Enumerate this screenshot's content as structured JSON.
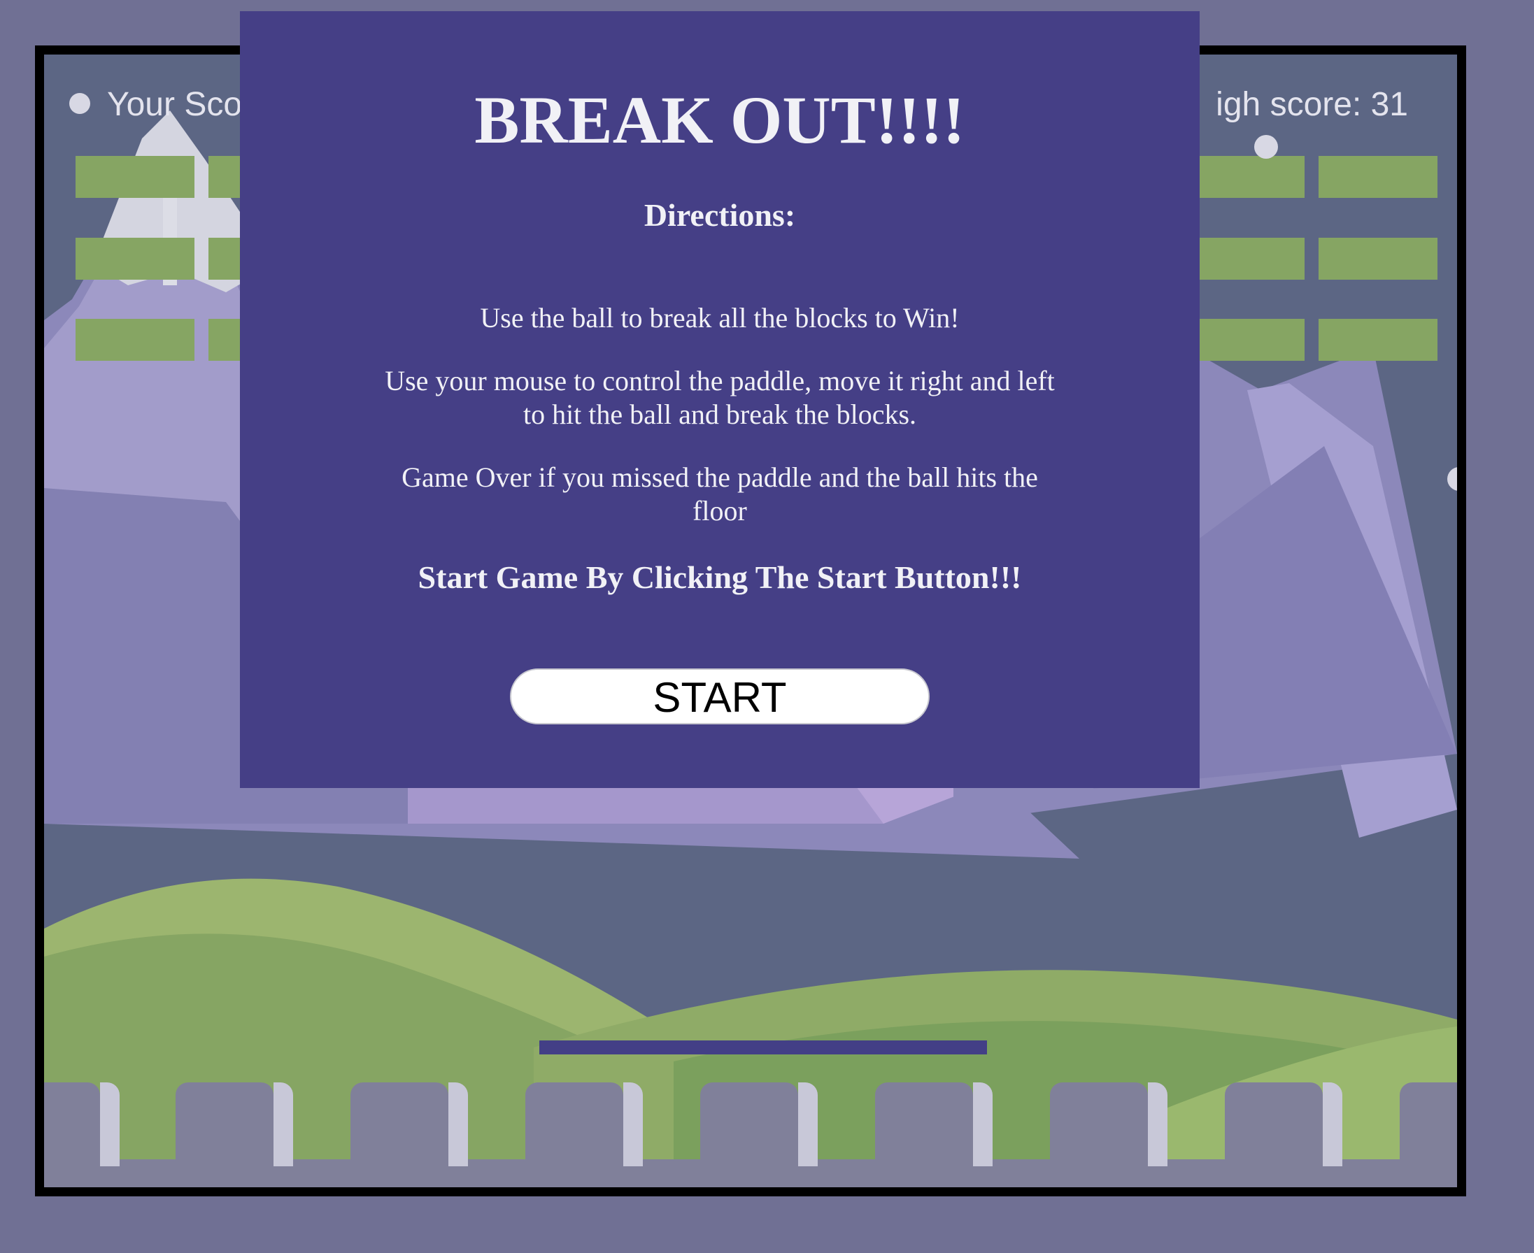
{
  "hud": {
    "score_label": "Your Sco",
    "high_score_label": "igh score: 31"
  },
  "modal": {
    "title": "BREAK OUT!!!!",
    "directions_heading": "Directions:",
    "paragraphs": [
      "Use the ball to break all the blocks to Win!",
      "Use your mouse to control the paddle, move it right and left to hit the ball and break the blocks.",
      "Game Over if you missed the paddle and the ball hits the floor"
    ],
    "call_to_action": "Start Game By Clicking The Start Button!!!",
    "start_button_label": "START"
  },
  "colors": {
    "page_background": "#707094",
    "modal_background": "#453f86",
    "brick": "#86a563",
    "paddle": "#433f86",
    "sky": "#5c6684"
  },
  "game": {
    "brick_rows": 3,
    "paddle_icon": "paddle",
    "ball_icon": "ball"
  }
}
